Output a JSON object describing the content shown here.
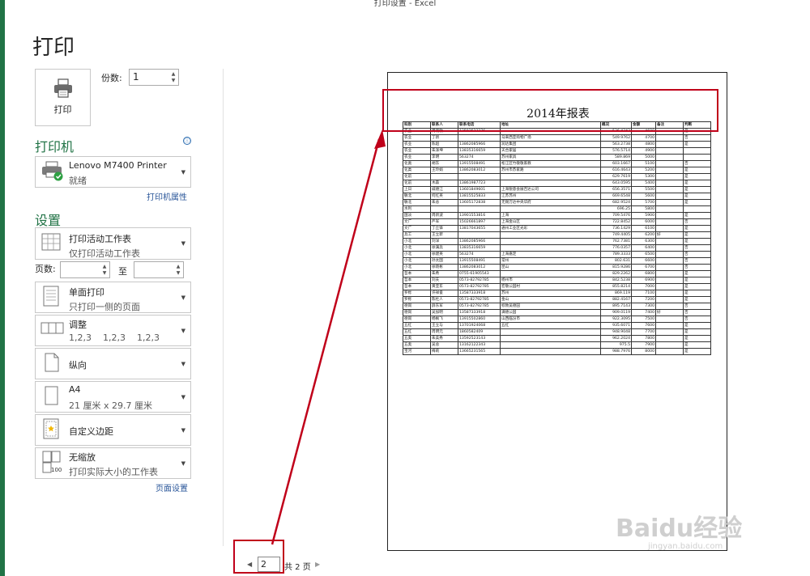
{
  "window": {
    "title": "打印设置 - Excel"
  },
  "page": {
    "heading": "打印"
  },
  "print_button": {
    "label": "打印"
  },
  "copies": {
    "label": "份数:",
    "value": "1"
  },
  "printer": {
    "section_title": "打印机",
    "name": "Lenovo M7400 Printer",
    "status": "就绪",
    "properties_link": "打印机属性",
    "info_icon": "ⓘ"
  },
  "settings": {
    "section_title": "设置",
    "items": [
      {
        "icon": "worksheet-icon",
        "title": "打印活动工作表",
        "subtitle": "仅打印活动工作表"
      },
      {
        "icon": "one-sided-icon",
        "title": "单面打印",
        "subtitle": "只打印一侧的页面"
      },
      {
        "icon": "collate-icon",
        "title": "调整",
        "subtitle": "1,2,3    1,2,3    1,2,3"
      },
      {
        "icon": "portrait-icon",
        "title": "纵向",
        "subtitle": ""
      },
      {
        "icon": "paper-icon",
        "title": "A4",
        "subtitle": "21 厘米 x 29.7 厘米"
      },
      {
        "icon": "margins-icon",
        "title": "自定义边距",
        "subtitle": ""
      },
      {
        "icon": "scaling-icon",
        "title": "无缩放",
        "subtitle": "打印实际大小的工作表"
      }
    ],
    "pages_label": "页数:",
    "to_label": "至",
    "page_setup_link": "页面设置"
  },
  "navigation": {
    "current_page": "2",
    "total": "共 2 页"
  },
  "preview": {
    "sheet_title": "2014年报表",
    "columns": [
      "科别",
      "联系人",
      "联系电话",
      "地址",
      "概况",
      "金额",
      "备注",
      "判断"
    ],
    "rows": [
      [
        "农业",
        "周晓敏",
        "13592523276",
        "",
        "536.4343",
        "4600",
        "",
        "是"
      ],
      [
        "农业",
        "丁新",
        "",
        "马来西亚购物广场",
        "549.9762",
        "4700",
        "",
        "否"
      ],
      [
        "农业",
        "陈超",
        "13862085966",
        "润达集团",
        "563.2738",
        "4800",
        "",
        "是"
      ],
      [
        "农业",
        "朱泽坤",
        "13835316659",
        "天合家居",
        "576.5714",
        "4900",
        "",
        ""
      ],
      [
        "农业",
        "李明",
        "563274",
        "苏州家具",
        "589.869",
        "5000",
        "",
        ""
      ],
      [
        "化类",
        "胡东",
        "13915508491",
        "松江区竹敬敬家教",
        "603.1667",
        "5100",
        "",
        "否"
      ],
      [
        "化类",
        "王玲娟",
        "13862083012",
        "苏州市苏家路",
        "616.4643",
        "5200",
        "",
        "是"
      ],
      [
        "化前",
        "",
        "",
        "",
        "629.7619",
        "5300",
        "",
        "是"
      ],
      [
        "化前",
        "木森",
        "13861987723",
        "",
        "643.0595",
        "5400",
        "",
        "是"
      ],
      [
        "上日",
        "威德江",
        "13601849601",
        "上海锐意会展百达公司",
        "656.3571",
        "5500",
        "",
        "是"
      ],
      [
        "敏北",
        "何红英",
        "13815525833",
        "江苏苏州",
        "669.6548",
        "5600",
        "",
        "是"
      ],
      [
        "敏北",
        "朱总",
        "13605172838",
        "无锡万达中央华府",
        "682.9524",
        "5700",
        "",
        "是"
      ],
      [
        "水利",
        "",
        "",
        "",
        "696.25",
        "5800",
        "",
        ""
      ],
      [
        "国淡",
        "周新波",
        "13901553816",
        "上海",
        "709.5476",
        "5900",
        "",
        "是"
      ],
      [
        "文广",
        "严军",
        "15026661897",
        "上海金山区",
        "722.8452",
        "6000",
        "",
        "否"
      ],
      [
        "文广",
        "丁丘锋",
        "13817043655",
        "通州工业区光彩",
        "736.1429",
        "6100",
        "",
        "是"
      ],
      [
        "兵工",
        "王立新",
        "",
        "",
        "749.4405",
        "6200",
        "好",
        "是"
      ],
      [
        "小北",
        "刘洋",
        "13862085966",
        "",
        "762.7381",
        "6300",
        "",
        "是"
      ],
      [
        "小北",
        "徐满兵",
        "13835316659",
        "",
        "776.0357",
        "6400",
        "",
        "否"
      ],
      [
        "小北",
        "徐建英",
        "563274",
        "上海嘉定",
        "789.3333",
        "6500",
        "",
        "否"
      ],
      [
        "小北",
        "孙太国",
        "13915508491",
        "常州",
        "802.631",
        "6600",
        "",
        "否"
      ],
      [
        "小北",
        "徐晓彬",
        "13862083012",
        "昆山",
        "815.9286",
        "6700",
        "",
        "否"
      ],
      [
        "哲本",
        "朱希",
        "0755-61905543",
        "",
        "829.2262",
        "6800",
        "",
        "是"
      ],
      [
        "哲本",
        "刘夫",
        "0573-82792785",
        "杨州市",
        "842.5238",
        "6900",
        "",
        "是"
      ],
      [
        "哲本",
        "黄亚东",
        "0573-82792785",
        "宏敬公园村",
        "855.8214",
        "7000",
        "",
        "是"
      ],
      [
        "罗栎",
        "许祥俊",
        "13587333918",
        "苏州",
        "869.119",
        "7100",
        "",
        "是"
      ],
      [
        "罗栎",
        "陈杜人",
        "0573-82792785",
        "金山",
        "882.4167",
        "7200",
        "",
        "是"
      ],
      [
        "德岗",
        "薛东军",
        "0573-82792785",
        "标致吴德园",
        "895.7143",
        "7300",
        "",
        "否"
      ],
      [
        "德岗",
        "吴加明",
        "13587333918",
        "满德公园",
        "909.0119",
        "7400",
        "好",
        "否"
      ],
      [
        "德岗",
        "杨枫飞",
        "13915502860",
        "山西临汾市",
        "922.3095",
        "7500",
        "",
        "否"
      ],
      [
        "五红",
        "王立与",
        "13701924068",
        "五红",
        "935.6071",
        "7600",
        "",
        "是"
      ],
      [
        "五红",
        "周明元",
        "1860582409",
        "",
        "948.9048",
        "7700",
        "",
        "是"
      ],
      [
        "五奥",
        "朱美秀",
        "13592523143",
        "",
        "962.2024",
        "7800",
        "",
        "是"
      ],
      [
        "五奥",
        "吴总",
        "13162122343",
        "",
        "975.5",
        "7900",
        "",
        "是"
      ],
      [
        "宝河",
        "梅莉",
        "13665231565",
        "",
        "988.7976",
        "8000",
        "",
        "是"
      ]
    ]
  },
  "watermark": {
    "brand": "Baidu经验",
    "url": "jingyan.baidu.com"
  },
  "colors": {
    "accent": "#217346",
    "annotation_red": "#c0001a",
    "link": "#2b579a"
  }
}
